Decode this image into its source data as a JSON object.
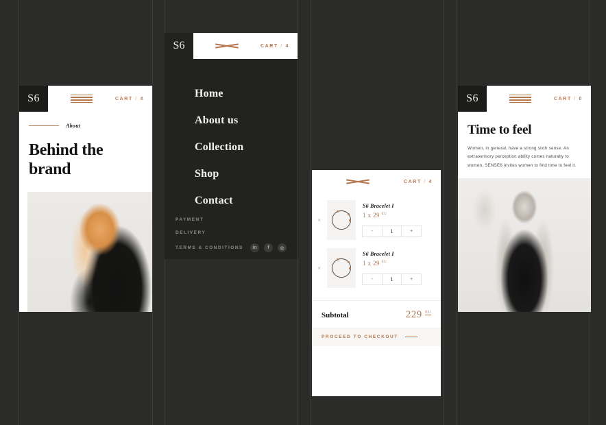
{
  "brand": {
    "logo": "S6",
    "accent": "#b5764f",
    "dark": "#22221f",
    "page_bg": "#2b2b29"
  },
  "panel_about": {
    "logo": "S6",
    "menu_icon": "hamburger-icon",
    "cart": {
      "label": "CART",
      "sep": "/",
      "count": "4"
    },
    "eyebrow": "About",
    "title": "Behind the brand",
    "image_alt": "woman-ginger-hair-black-coat"
  },
  "panel_menu": {
    "logo": "S6",
    "close_icon": "close-x-icon",
    "cart": {
      "label": "CART",
      "sep": "/",
      "count": "4"
    },
    "items": [
      {
        "label": "Home"
      },
      {
        "label": "About us"
      },
      {
        "label": "Collection"
      },
      {
        "label": "Shop"
      },
      {
        "label": "Contact"
      }
    ],
    "footer_links": [
      {
        "label": "PAYMENT"
      },
      {
        "label": "DELIVERY"
      },
      {
        "label": "TERMS & CONDITIONS"
      }
    ],
    "socials": [
      {
        "name": "linkedin-icon",
        "glyph": "in"
      },
      {
        "name": "facebook-icon",
        "glyph": "f"
      },
      {
        "name": "instagram-icon",
        "glyph": "◎"
      }
    ]
  },
  "panel_cart": {
    "close_icon": "close-x-icon",
    "cart": {
      "label": "CART",
      "sep": "/",
      "count": "4"
    },
    "items": [
      {
        "remove": "×",
        "name": "S6 Bracelet I",
        "price": "1 x 29",
        "currency": "EU",
        "minus": "-",
        "qty": "1",
        "plus": "+",
        "thumb_alt": "bracelet-ring-thumbnail"
      },
      {
        "remove": "×",
        "name": "S6 Bracelet I",
        "price": "1 x 29",
        "currency": "EU",
        "minus": "-",
        "qty": "1",
        "plus": "+",
        "thumb_alt": "bracelet-ring-thumbnail"
      }
    ],
    "subtotal_label": "Subtotal",
    "subtotal_value": "229",
    "subtotal_currency": "EU",
    "checkout_label": "PROCEED TO CHECKOUT"
  },
  "panel_hero": {
    "logo": "S6",
    "menu_icon": "hamburger-icon",
    "cart": {
      "label": "CART",
      "sep": "/",
      "count": "0"
    },
    "title": "Time to feel",
    "lede": "Women, in general, have a strong sixth sense. An extrasensory perception ability comes naturally to women. SENSE6 invites women to find time to feel it.",
    "image_alt": "woman-long-blonde-hair-black-turtleneck"
  }
}
